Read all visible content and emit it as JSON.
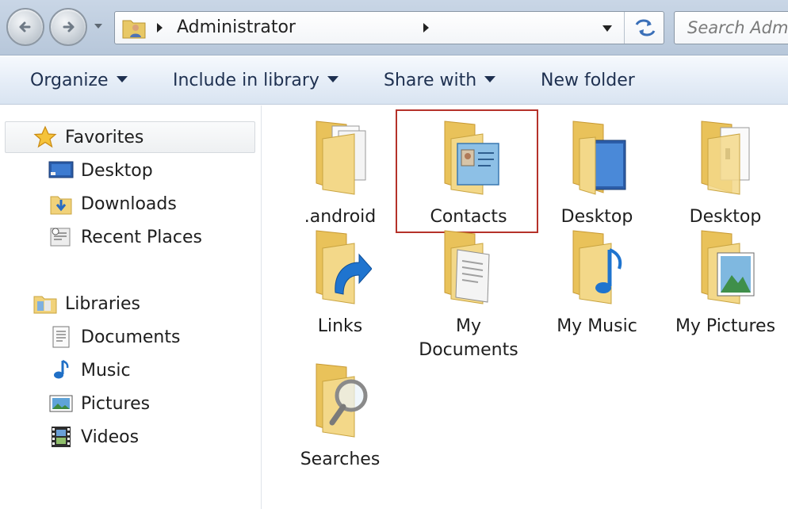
{
  "address_bar": {
    "path_segment": "Administrator",
    "search_placeholder": "Search Administrator"
  },
  "toolbar": {
    "organize": "Organize",
    "include_in_library": "Include in library",
    "share_with": "Share with",
    "new_folder": "New folder"
  },
  "navigation": {
    "favorites": {
      "label": "Favorites",
      "items": [
        "Desktop",
        "Downloads",
        "Recent Places"
      ]
    },
    "libraries": {
      "label": "Libraries",
      "items": [
        "Documents",
        "Music",
        "Pictures",
        "Videos"
      ]
    }
  },
  "content": {
    "selected_item": "Contacts",
    "items": [
      {
        "label": ".android",
        "icon": "folder-documents-icon"
      },
      {
        "label": "Contacts",
        "icon": "folder-contacts-icon"
      },
      {
        "label": "Desktop",
        "icon": "folder-desktop-icon"
      },
      {
        "label": "Desktop",
        "icon": "folder-document-icon"
      },
      {
        "label": "Links",
        "icon": "folder-links-icon"
      },
      {
        "label": "My Documents",
        "label_line1": "My",
        "label_line2": "Documents",
        "icon": "folder-my-documents-icon"
      },
      {
        "label": "My Music",
        "icon": "folder-music-icon"
      },
      {
        "label": "My Pictures",
        "icon": "folder-pictures-icon"
      },
      {
        "label": "Searches",
        "icon": "folder-search-icon"
      }
    ]
  },
  "colors": {
    "selection_border": "#b5322a",
    "toolbar_text": "#1e3050",
    "folder": "#f1d27a"
  }
}
